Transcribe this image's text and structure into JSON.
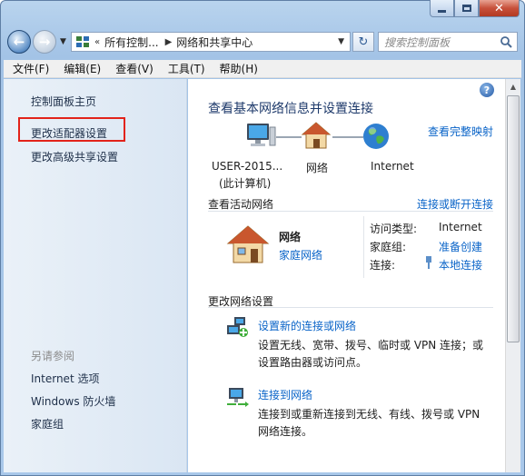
{
  "window": {
    "controls": {
      "minimize": "minimize",
      "maximize": "maximize",
      "close": "✕"
    }
  },
  "nav": {
    "address": {
      "crumbs": [
        "所有控制...",
        "网络和共享中心"
      ],
      "overflow": "«"
    },
    "search_placeholder": "搜索控制面板"
  },
  "menu": [
    "文件(F)",
    "编辑(E)",
    "查看(V)",
    "工具(T)",
    "帮助(H)"
  ],
  "sidebar": {
    "home": "控制面板主页",
    "items": [
      "更改适配器设置",
      "更改高级共享设置"
    ],
    "see_also_title": "另请参阅",
    "see_also": [
      "Internet 选项",
      "Windows 防火墙",
      "家庭组"
    ]
  },
  "main": {
    "title": "查看基本网络信息并设置连接",
    "full_map_link": "查看完整映射",
    "map": {
      "nodes": [
        {
          "label": "USER-2015...",
          "sub": "(此计算机)"
        },
        {
          "label": "网络",
          "sub": ""
        },
        {
          "label": "Internet",
          "sub": ""
        }
      ]
    },
    "active_networks": {
      "heading": "查看活动网络",
      "connect_link": "连接或断开连接",
      "network_name": "网络",
      "network_type": "家庭网络",
      "access_type_label": "访问类型:",
      "access_type_value": "Internet",
      "homegroup_label": "家庭组:",
      "homegroup_value": "准备创建",
      "connections_label": "连接:",
      "connections_value": "本地连接"
    },
    "change_settings": {
      "heading": "更改网络设置",
      "tasks": [
        {
          "title": "设置新的连接或网络",
          "desc": "设置无线、宽带、拨号、临时或 VPN 连接；或设置路由器或访问点。"
        },
        {
          "title": "连接到网络",
          "desc": "连接到或重新连接到无线、有线、拨号或 VPN 网络连接。"
        }
      ]
    }
  },
  "colors": {
    "link": "#0a64c8",
    "title": "#1e3a6b",
    "highlight": "#e2231a"
  }
}
